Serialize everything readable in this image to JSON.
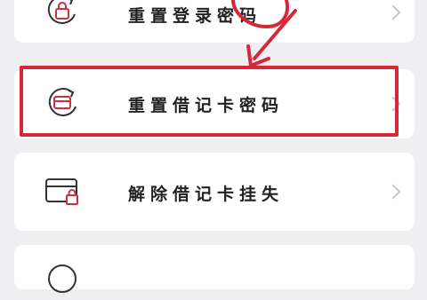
{
  "menu": {
    "items": [
      {
        "label": "重置登录密码",
        "icon": "lock-reset-icon"
      },
      {
        "label": "重置借记卡密码",
        "icon": "card-reset-icon"
      },
      {
        "label": "解除借记卡挂失",
        "icon": "card-lock-icon"
      }
    ]
  },
  "colors": {
    "highlight": "#d7283a",
    "icon_accent": "#c8333f",
    "background": "#efeff2"
  }
}
